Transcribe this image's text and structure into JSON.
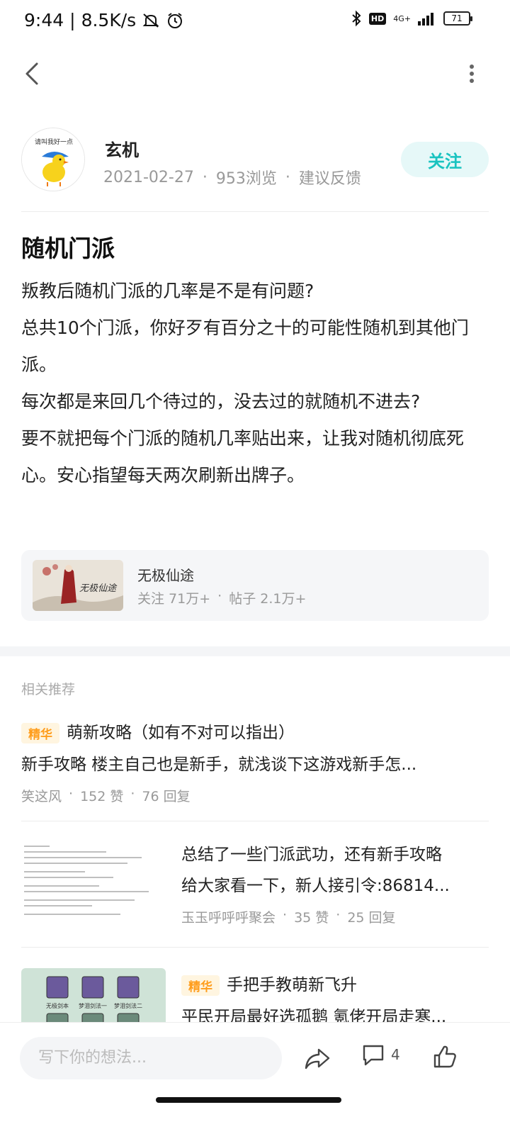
{
  "status_bar": {
    "time": "9:44",
    "speed": "8.5K/s",
    "network": "4G+",
    "hd": "HD",
    "battery": "71"
  },
  "author": {
    "name": "玄机",
    "date": "2021-02-27",
    "views": "953浏览",
    "feedback": "建议反馈",
    "follow_label": "关注",
    "avatar_text": "请叫我好一点"
  },
  "post": {
    "title": "随机门派",
    "lines": [
      "叛教后随机门派的几率是不是有问题?",
      "总共10个门派，你好歹有百分之十的可能性随机到其他门派。",
      "每次都是来回几个待过的，没去过的就随机不进去?",
      "要不就把每个门派的随机几率贴出来，让我对随机彻底死心。安心指望每天两次刷新出牌子。"
    ]
  },
  "game_card": {
    "name": "无极仙途",
    "followers": "关注 71万+",
    "posts": "帖子 2.1万+",
    "thumb_text": "无极仙途"
  },
  "related": {
    "section_title": "相关推荐",
    "items": [
      {
        "badge": "精华",
        "title": "萌新攻略（如有不对可以指出）",
        "subtitle": "新手攻略   楼主自己也是新手，就浅谈下这游戏新手怎...",
        "author": "笑这风",
        "likes": "152 赞",
        "replies": "76 回复"
      },
      {
        "badge": "",
        "title": "总结了一些门派武功，还有新手攻略",
        "subtitle": "给大家看一下，新人接引令:86814...",
        "author": "玉玉呼呼呼聚会",
        "likes": "35 赞",
        "replies": "25 回复"
      },
      {
        "badge": "精华",
        "title": "手把手教萌新飞升",
        "subtitle": "平民开局最好选孤鹅 氪佬开局走寒...",
        "thumb_labels": [
          "无极剑本",
          "梦泪剑法一",
          "梦泪剑法二"
        ]
      }
    ]
  },
  "bottom_bar": {
    "input_placeholder": "写下你的想法...",
    "comment_count": "4"
  }
}
